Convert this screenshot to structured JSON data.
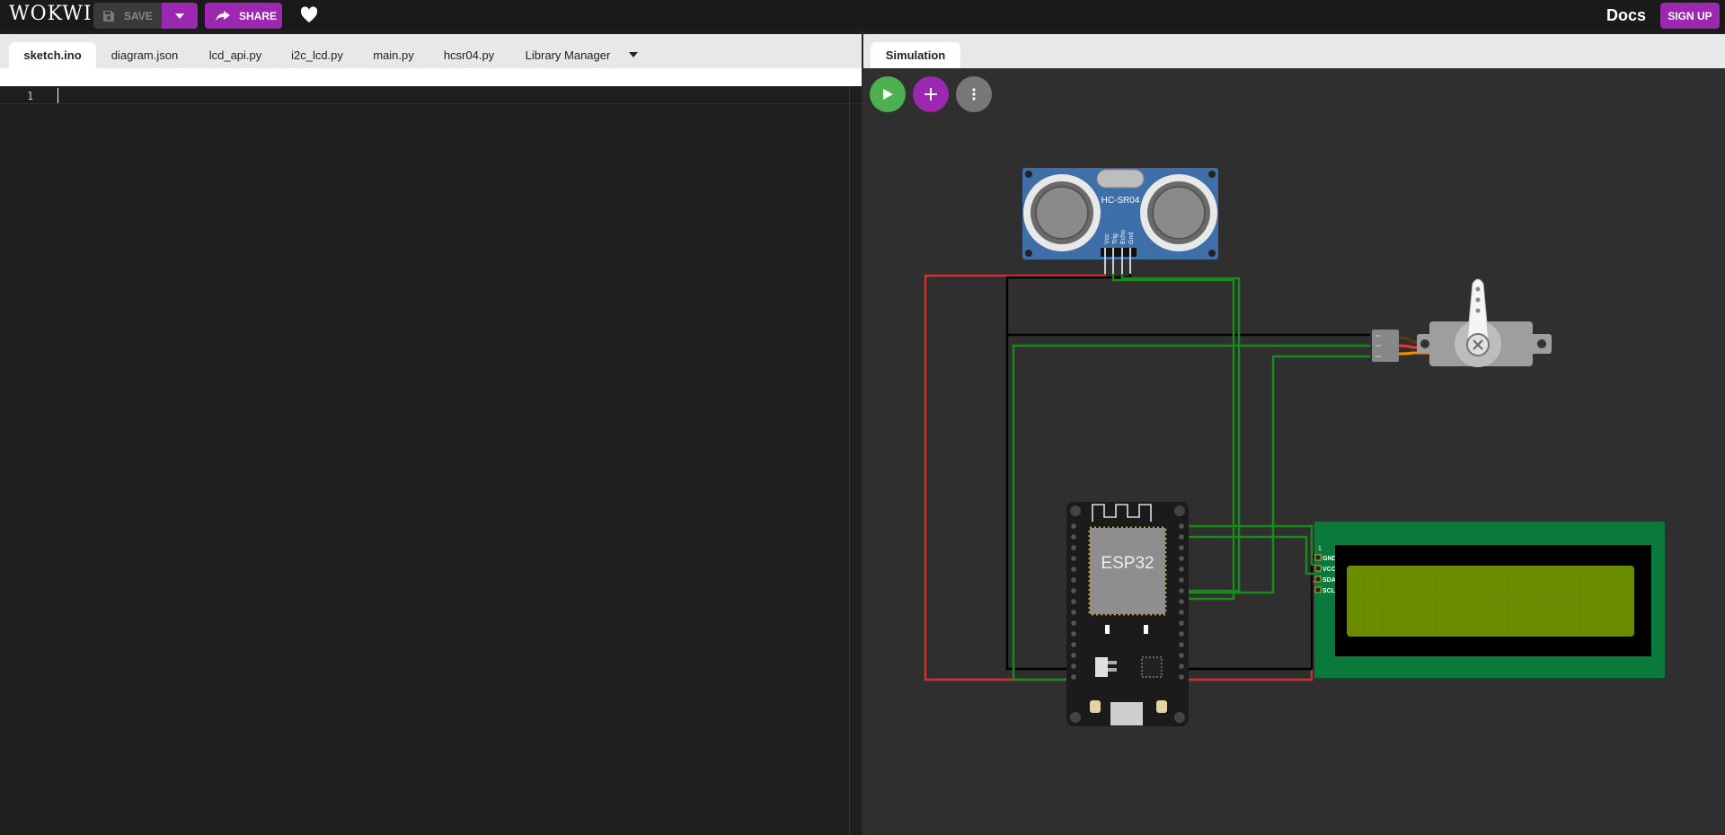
{
  "topbar": {
    "logo": "WOKWI",
    "save_label": "SAVE",
    "share_label": "SHARE",
    "docs_label": "Docs",
    "signup_label": "SIGN UP"
  },
  "editor": {
    "tabs": [
      {
        "label": "sketch.ino",
        "active": true
      },
      {
        "label": "diagram.json",
        "active": false
      },
      {
        "label": "lcd_api.py",
        "active": false
      },
      {
        "label": "i2c_lcd.py",
        "active": false
      },
      {
        "label": "main.py",
        "active": false
      },
      {
        "label": "hcsr04.py",
        "active": false
      },
      {
        "label": "Library Manager",
        "active": false
      }
    ],
    "line_number": "1"
  },
  "simulation": {
    "tab_label": "Simulation",
    "components": {
      "ultrasonic_label": "HC-SR04",
      "ultrasonic_pins": [
        "Vcc",
        "Trig",
        "Echo",
        "Gnd"
      ],
      "mcu_label": "ESP32",
      "lcd_pins": [
        "GND",
        "VCC",
        "SDA",
        "SCL"
      ],
      "lcd_pin_header": "1"
    }
  },
  "colors": {
    "accent": "#9c27b0",
    "run": "#4caf50",
    "wire_red": "#d32f2f",
    "wire_green": "#1b8a1b",
    "wire_black": "#000000"
  }
}
